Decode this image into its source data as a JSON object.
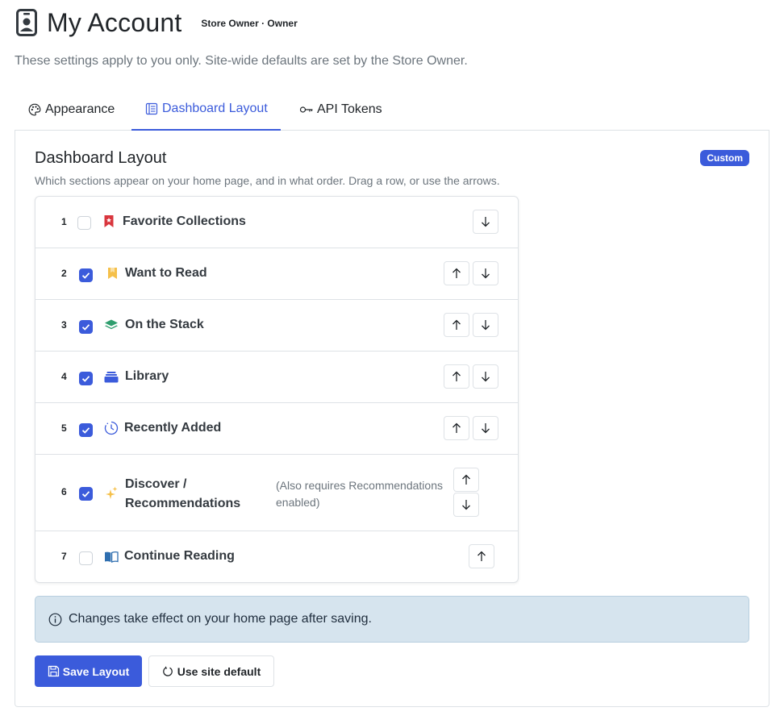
{
  "header": {
    "title": "My Account",
    "role": "Store Owner · Owner",
    "subtitle": "These settings apply to you only. Site-wide defaults are set by the Store Owner."
  },
  "tabs": [
    {
      "label": "Appearance",
      "icon": "palette-icon",
      "active": false
    },
    {
      "label": "Dashboard Layout",
      "icon": "layout-icon",
      "active": true
    },
    {
      "label": "API Tokens",
      "icon": "key-icon",
      "active": false
    }
  ],
  "layout": {
    "title": "Dashboard Layout",
    "badge": "Custom",
    "description": "Which sections appear on your home page, and in what order. Drag a row, or use the arrows.",
    "rows": [
      {
        "num": "1",
        "label": "Favorite Collections",
        "checked": false,
        "icon": "bookmark-red-icon",
        "note": ""
      },
      {
        "num": "2",
        "label": "Want to Read",
        "checked": true,
        "icon": "bookmark-yellow-icon",
        "note": ""
      },
      {
        "num": "3",
        "label": "On the Stack",
        "checked": true,
        "icon": "layers-icon",
        "note": ""
      },
      {
        "num": "4",
        "label": "Library",
        "checked": true,
        "icon": "library-icon",
        "note": ""
      },
      {
        "num": "5",
        "label": "Recently Added",
        "checked": true,
        "icon": "clock-icon",
        "note": ""
      },
      {
        "num": "6",
        "label": "Discover / Recommendations",
        "label_line1": "Discover /",
        "label_line2": "Recommendations",
        "checked": true,
        "icon": "sparkles-icon",
        "note": "(Also requires Recommendations enabled)",
        "note_line1": "(Also requires Recommendations",
        "note_line2": "enabled)"
      },
      {
        "num": "7",
        "label": "Continue Reading",
        "checked": false,
        "icon": "book-open-icon",
        "note": ""
      }
    ],
    "alert": "Changes take effect on your home page after saving.",
    "save_label": "Save Layout",
    "default_label": "Use site default"
  },
  "colors": {
    "accent": "#3b5bdb",
    "alert_bg": "#d6e4ee",
    "bookmark_red": "#d9363e",
    "bookmark_yellow": "#f5c04a",
    "layers_green": "#2f9e6e"
  }
}
